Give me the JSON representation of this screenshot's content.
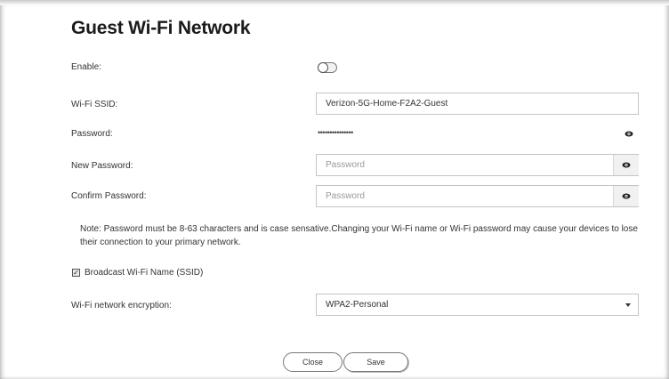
{
  "title": "Guest Wi-Fi Network",
  "enable": {
    "label": "Enable:",
    "on": false
  },
  "ssid": {
    "label": "Wi-Fi SSID:",
    "value": "Verizon-5G-Home-F2A2-Guest"
  },
  "password": {
    "label": "Password:",
    "masked": "•••••••••••••••"
  },
  "new_password": {
    "label": "New Password:",
    "placeholder": "Password"
  },
  "confirm_password": {
    "label": "Confirm Password:",
    "placeholder": "Password"
  },
  "note": "Note: Password must be 8-63 characters and is case sensative.Changing your Wi-Fi name or Wi-Fi password may cause your devices to lose their connection to your primary network.",
  "broadcast": {
    "label": "Broadcast Wi-Fi Name (SSID)",
    "checked": true
  },
  "encryption": {
    "label": "Wi-Fi network encryption:",
    "value": "WPA2-Personal"
  },
  "buttons": {
    "close": "Close",
    "save": "Save"
  }
}
